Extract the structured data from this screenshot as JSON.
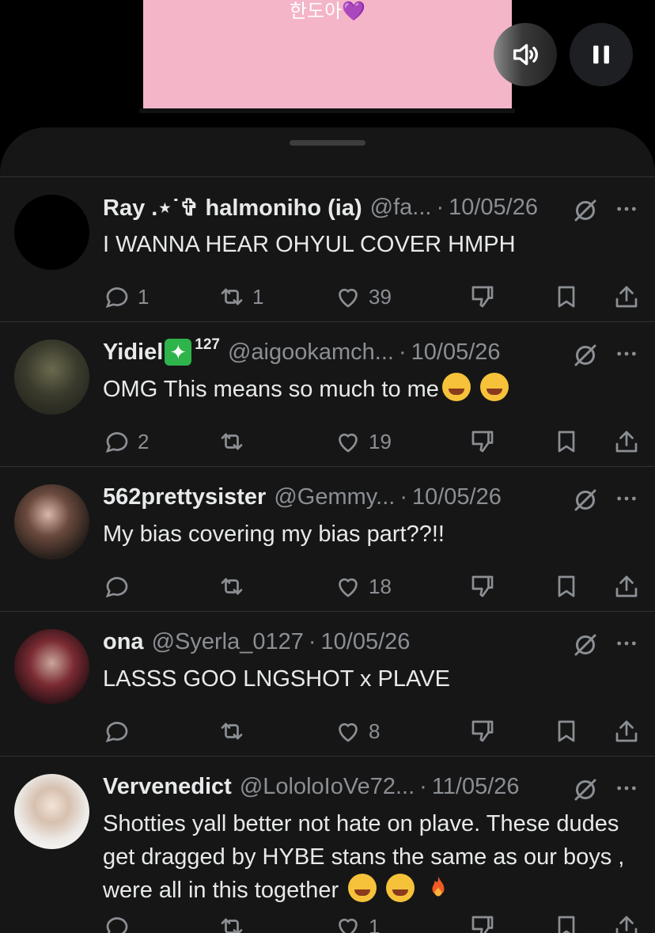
{
  "video": {
    "caption": "한도아💜",
    "background": "#f4b5c9"
  },
  "controls": {
    "volume_icon": "volume-icon",
    "pause_icon": "pause-icon"
  },
  "replies": [
    {
      "name": "Ray .⋆˙✞ halmoniho (ia)",
      "handle": "@fa...",
      "date": "10/05/26",
      "text": "I WANNA HEAR OHYUL COVER HMPH",
      "emojis": [],
      "replies": "1",
      "reposts": "1",
      "likes": "39",
      "badge": "",
      "sup": ""
    },
    {
      "name": "Yidiel",
      "handle": "@aigookamch...",
      "date": "10/05/26",
      "text": "OMG This means so much to me",
      "emojis": [
        "loudly-crying-face",
        "loudly-crying-face"
      ],
      "replies": "2",
      "reposts": "",
      "likes": "19",
      "badge": "✦",
      "sup": "127"
    },
    {
      "name": "562prettysister",
      "handle": "@Gemmy...",
      "date": "10/05/26",
      "text": "My bias covering my bias part??!!",
      "emojis": [],
      "replies": "",
      "reposts": "",
      "likes": "18",
      "badge": "",
      "sup": ""
    },
    {
      "name": "ona",
      "handle": "@Syerla_0127",
      "date": "10/05/26",
      "text": "LASSS GOO LNGSHOT x PLAVE",
      "emojis": [],
      "replies": "",
      "reposts": "",
      "likes": "8",
      "badge": "",
      "sup": ""
    },
    {
      "name": "Vervenedict",
      "handle": "@LololoIoVe72...",
      "date": "11/05/26",
      "text": "Shotties yall better not hate on plave. These dudes get dragged by  HYBE stans the same as our boys , were all in this together",
      "emojis": [
        "tears-of-joy",
        "tears-of-joy",
        "fire"
      ],
      "replies": "",
      "reposts": "",
      "likes": "1",
      "badge": "",
      "sup": ""
    }
  ]
}
